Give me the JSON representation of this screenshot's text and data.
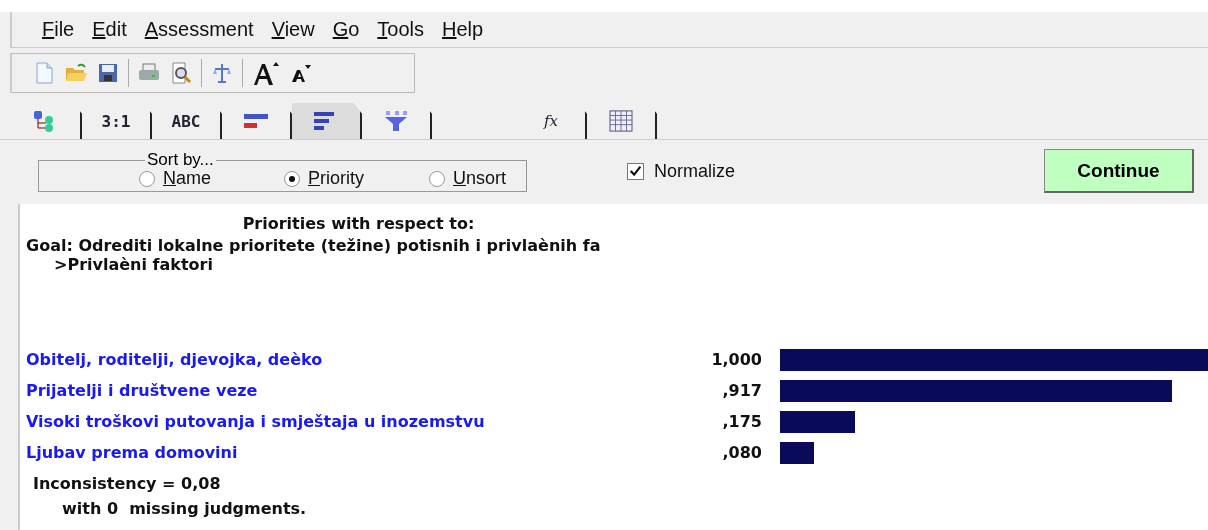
{
  "menu": [
    {
      "label": "File"
    },
    {
      "label": "Edit"
    },
    {
      "label": "Assessment"
    },
    {
      "label": "View"
    },
    {
      "label": "Go"
    },
    {
      "label": "Tools"
    },
    {
      "label": "Help"
    }
  ],
  "toolbar": [
    {
      "kind": "new"
    },
    {
      "kind": "open"
    },
    {
      "kind": "save"
    },
    {
      "kind": "sep"
    },
    {
      "kind": "print"
    },
    {
      "kind": "preview"
    },
    {
      "kind": "sep"
    },
    {
      "kind": "balance"
    },
    {
      "kind": "sep"
    },
    {
      "kind": "font-up"
    },
    {
      "kind": "font-down"
    }
  ],
  "tab_groups": [
    [
      {
        "kind": "tree",
        "selected": false
      },
      {
        "kind": "text",
        "label": "3:1",
        "selected": false
      },
      {
        "kind": "text",
        "label": "ABC",
        "selected": false
      },
      {
        "kind": "bars",
        "selected": false
      },
      {
        "kind": "sorted",
        "selected": true
      },
      {
        "kind": "funnel",
        "selected": false
      }
    ],
    [
      {
        "kind": "fx",
        "label": "fx",
        "selected": false
      },
      {
        "kind": "grid",
        "selected": false
      }
    ]
  ],
  "sort": {
    "title": "Sort by...",
    "options": [
      {
        "label": "Name",
        "selected": false
      },
      {
        "label": "Priority",
        "selected": true
      },
      {
        "label": "Unsort",
        "selected": false
      }
    ]
  },
  "normalize": {
    "label": "Normalize",
    "checked": true
  },
  "continue_button": "Continue",
  "report": {
    "heading": "Priorities with respect to:",
    "goal": "Goal: Odrediti lokalne prioritete (težine) potisnih i privlaènih fa",
    "node": ">Privlaèni faktori",
    "items": [
      {
        "name": "Obitelj, roditelji, djevojka, deèko",
        "value": "1,000"
      },
      {
        "name": "Prijatelji i društvene veze",
        "value": ",917"
      },
      {
        "name": "Visoki troškovi putovanja i smještaja u inozemstvu",
        "value": ",175"
      },
      {
        "name": "Ljubav prema domovini",
        "value": ",080"
      }
    ],
    "inconsistency": "Inconsistency = 0,08",
    "missing": "with 0  missing judgments."
  }
}
